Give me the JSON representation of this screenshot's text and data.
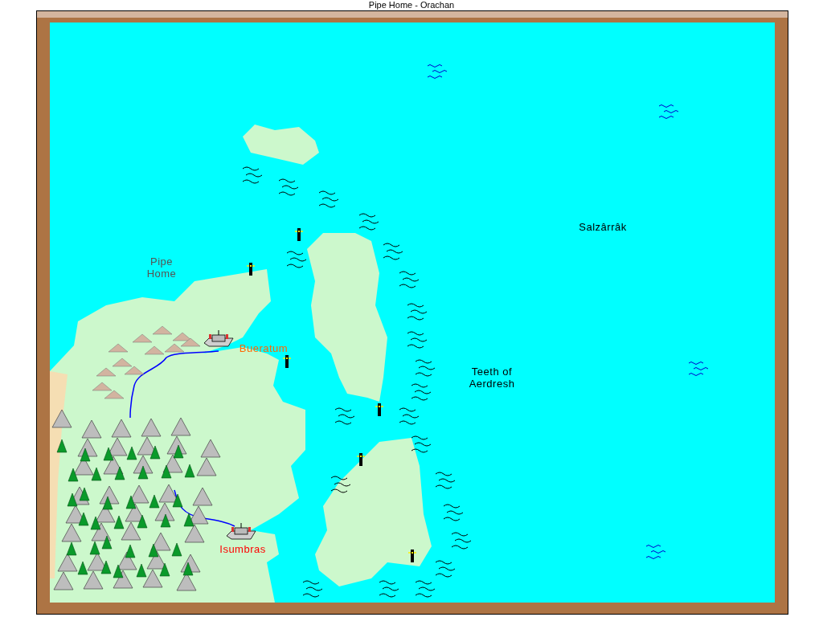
{
  "window": {
    "title": "Pipe Home - Orachan"
  },
  "map": {
    "labels": [
      {
        "kind": "region",
        "text": "Pipe Home"
      },
      {
        "kind": "sea",
        "text": "Salzârrâk"
      },
      {
        "kind": "city",
        "text": "Bueratum",
        "color": "#ff6600"
      },
      {
        "kind": "sea",
        "text": "Teeth of Aerdresh"
      },
      {
        "kind": "city",
        "text": "Isumbras",
        "color": "#ff0000"
      }
    ]
  }
}
